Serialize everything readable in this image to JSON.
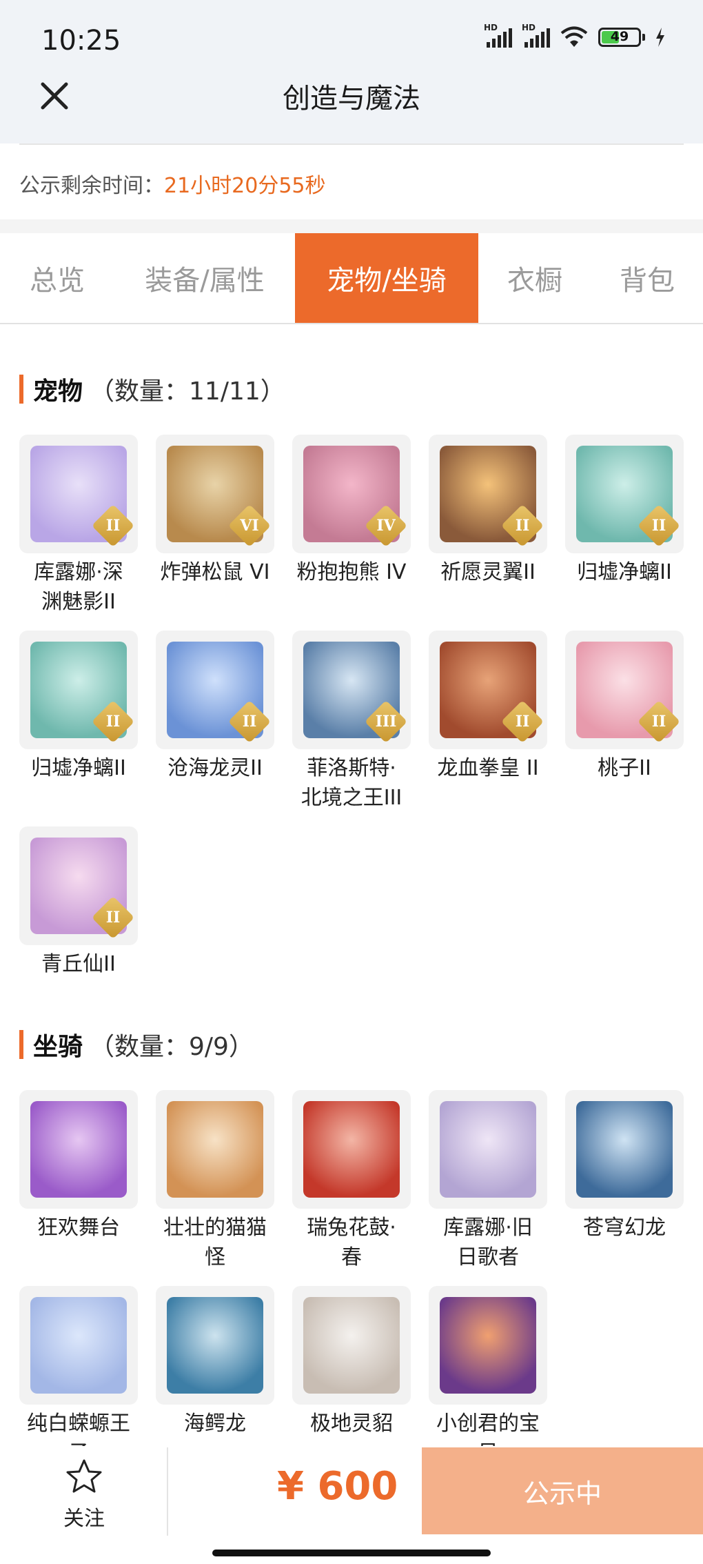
{
  "status": {
    "time": "10:25",
    "battery": "49",
    "hd1": "HD",
    "hd2": "HD"
  },
  "nav": {
    "title": "创造与魔法",
    "close_icon": "close-icon"
  },
  "countdown": {
    "label": "公示剩余时间：",
    "value": "21小时20分55秒"
  },
  "tabs": [
    {
      "label": "总览",
      "active": false
    },
    {
      "label": "装备/属性",
      "active": false
    },
    {
      "label": "宠物/坐骑",
      "active": true
    },
    {
      "label": "衣橱",
      "active": false
    },
    {
      "label": "背包",
      "active": false
    }
  ],
  "pets": {
    "title": "宠物",
    "count": "（数量：11/11）",
    "items": [
      {
        "name": "库露娜·深渊魅影II",
        "line1": "库露娜·深",
        "line2": "渊魅影II",
        "rank": "II"
      },
      {
        "name": "炸弹松鼠 VI",
        "line1": "炸弹松鼠 VI",
        "line2": "",
        "rank": "VI"
      },
      {
        "name": "粉抱抱熊 IV",
        "line1": "粉抱抱熊 IV",
        "line2": "",
        "rank": "IV"
      },
      {
        "name": "祈愿灵翼II",
        "line1": "祈愿灵翼II",
        "line2": "",
        "rank": "II"
      },
      {
        "name": "归墟净螭II",
        "line1": "归墟净螭II",
        "line2": "",
        "rank": "II"
      },
      {
        "name": "归墟净螭II",
        "line1": "归墟净螭II",
        "line2": "",
        "rank": "II"
      },
      {
        "name": "沧海龙灵II",
        "line1": "沧海龙灵II",
        "line2": "",
        "rank": "II"
      },
      {
        "name": "菲洛斯特·北境之王III",
        "line1": "菲洛斯特·",
        "line2": "北境之王III",
        "rank": "III"
      },
      {
        "name": "龙血拳皇 II",
        "line1": "龙血拳皇 II",
        "line2": "",
        "rank": "II"
      },
      {
        "name": "桃子II",
        "line1": "桃子II",
        "line2": "",
        "rank": "II"
      },
      {
        "name": "青丘仙II",
        "line1": "青丘仙II",
        "line2": "",
        "rank": "II"
      }
    ]
  },
  "mounts": {
    "title": "坐骑",
    "count": "（数量：9/9）",
    "items": [
      {
        "name": "狂欢舞台",
        "line1": "狂欢舞台",
        "line2": ""
      },
      {
        "name": "壮壮的猫猫怪",
        "line1": "壮壮的猫猫",
        "line2": "怪"
      },
      {
        "name": "瑞兔花鼓·春",
        "line1": "瑞兔花鼓·",
        "line2": "春"
      },
      {
        "name": "库露娜·旧日歌者",
        "line1": "库露娜·旧",
        "line2": "日歌者"
      },
      {
        "name": "苍穹幻龙",
        "line1": "苍穹幻龙",
        "line2": ""
      },
      {
        "name": "纯白蝾螈王子",
        "line1": "纯白蝾螈王",
        "line2": "子"
      },
      {
        "name": "海鳄龙",
        "line1": "海鳄龙",
        "line2": ""
      },
      {
        "name": "极地灵貂",
        "line1": "极地灵貂",
        "line2": ""
      },
      {
        "name": "小创君的宝贝",
        "line1": "小创君的宝",
        "line2": "贝"
      }
    ]
  },
  "bottom": {
    "follow_label": "关注",
    "follow_icon": "star-icon",
    "price": "¥ 600",
    "button_label": "公示中"
  },
  "colors": {
    "accent": "#ec6a2b",
    "button": "#f4b08a",
    "topbar": "#f0f3f7"
  }
}
